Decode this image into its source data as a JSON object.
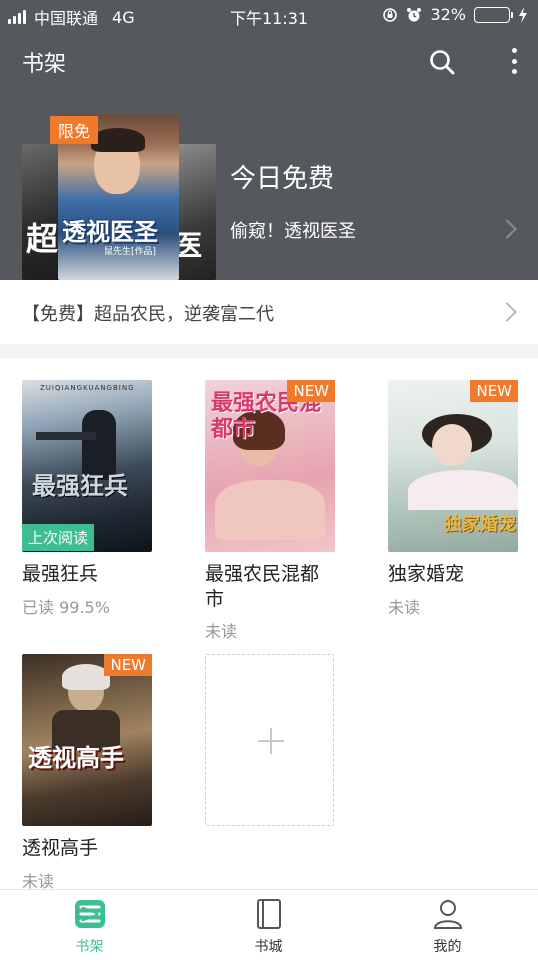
{
  "status_bar": {
    "carrier": "中国联通",
    "network": "4G",
    "time": "下午11:31",
    "battery": "32%",
    "battery_level": 0.32
  },
  "appbar": {
    "title": "书架",
    "search_icon": "search-icon",
    "more_icon": "more-vertical-icon"
  },
  "promo": {
    "badge": "限免",
    "title": "今日免费",
    "subtitle": "偷窥！透视医圣",
    "cover_title": "透视医圣",
    "cover_author": "鼠先生[作品]",
    "side_left_title": "超",
    "side_right_title": "医"
  },
  "free_line": "【免费】超品农民，逆袭富二代",
  "books": [
    {
      "title": "最强狂兵",
      "progress": "已读 99.5%",
      "badge": "上次阅读",
      "cover_text": "最强狂兵",
      "cover_top": "ZUIQIANGKUANGBING"
    },
    {
      "title": "最强农民混都市",
      "progress": "未读",
      "badge": "NEW",
      "cover_text": "最强农民混都市"
    },
    {
      "title": "独家婚宠",
      "progress": "未读",
      "badge": "NEW",
      "cover_text": "独家婚宠"
    },
    {
      "title": "透视高手",
      "progress": "未读",
      "badge": "NEW",
      "cover_text": "透视高手"
    }
  ],
  "tabs": [
    {
      "label": "书架",
      "icon": "bookshelf-icon",
      "active": true
    },
    {
      "label": "书城",
      "icon": "book-icon",
      "active": false
    },
    {
      "label": "我的",
      "icon": "user-icon",
      "active": false
    }
  ],
  "colors": {
    "header": "#55595e",
    "accent": "#3ebd93",
    "badge": "#f07a2c"
  }
}
